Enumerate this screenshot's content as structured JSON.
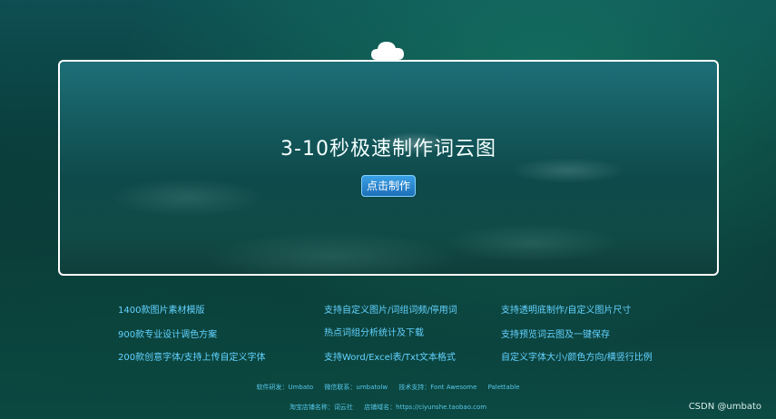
{
  "hero": {
    "title": "3-10秒极速制作词云图",
    "button_label": "点击制作",
    "top_icon": "cloud-icon"
  },
  "features": [
    "1400款图片素材模版",
    "支持自定义图片/词组词频/停用词",
    "支持透明底制作/自定义图片尺寸",
    "900款专业设计调色方案",
    "热点词组分析统计及下载",
    "支持预览词云图及一键保存",
    "200款创意字体/支持上传自定义字体",
    "支持Word/Excel表/Txt文本格式",
    "自定义字体大小/颜色方向/横竖行比例"
  ],
  "footer": {
    "line1": [
      "软件研发：Umbato",
      "微信联系：umbatolw",
      "技术支持：Font Awesome",
      "Palettable"
    ],
    "line2": [
      "淘宝店铺名称：词云社",
      "店铺域名：https://ciyunshe.taobao.com"
    ]
  },
  "watermark": "CSDN @umbato"
}
